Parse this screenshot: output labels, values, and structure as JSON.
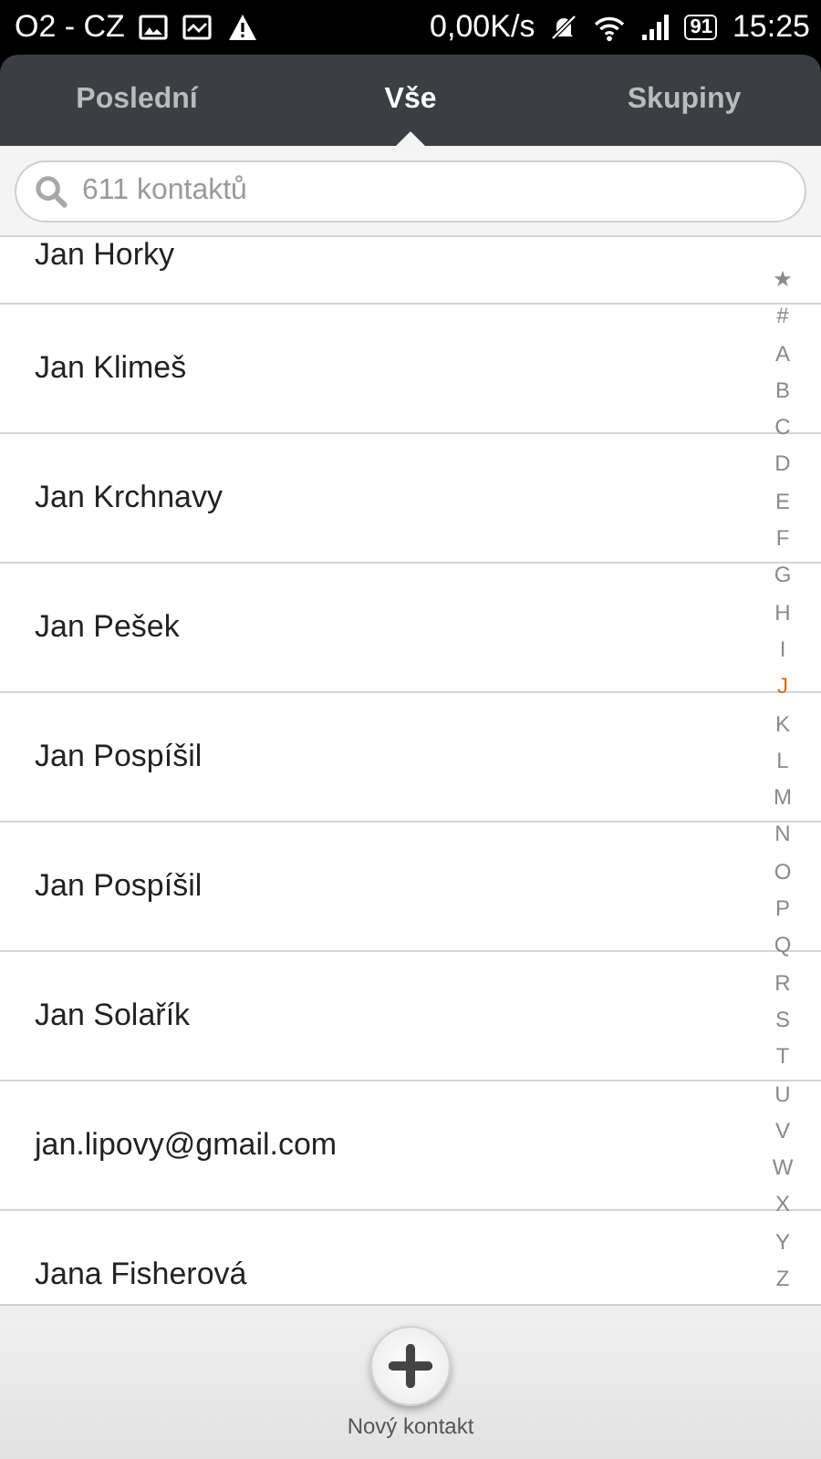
{
  "status_bar": {
    "carrier": "O2 - CZ",
    "speed": "0,00K/s",
    "battery": "91",
    "time": "15:25"
  },
  "tabs": [
    {
      "label": "Poslední",
      "selected": false
    },
    {
      "label": "Vše",
      "selected": true
    },
    {
      "label": "Skupiny",
      "selected": false
    }
  ],
  "search": {
    "placeholder": "611 kontaktů"
  },
  "contacts": [
    "Jan Horky",
    "Jan Klimeš",
    "Jan Krchnavy",
    "Jan Pešek",
    "Jan Pospíšil",
    "Jan Pospíšil",
    "Jan Solařík",
    "jan.lipovy@gmail.com",
    "Jana Fisherová"
  ],
  "index": [
    {
      "label": "★",
      "selected": false
    },
    {
      "label": "#",
      "selected": false
    },
    {
      "label": "A",
      "selected": false
    },
    {
      "label": "B",
      "selected": false
    },
    {
      "label": "C",
      "selected": false
    },
    {
      "label": "D",
      "selected": false
    },
    {
      "label": "E",
      "selected": false
    },
    {
      "label": "F",
      "selected": false
    },
    {
      "label": "G",
      "selected": false
    },
    {
      "label": "H",
      "selected": false
    },
    {
      "label": "I",
      "selected": false
    },
    {
      "label": "J",
      "selected": true
    },
    {
      "label": "K",
      "selected": false
    },
    {
      "label": "L",
      "selected": false
    },
    {
      "label": "M",
      "selected": false
    },
    {
      "label": "N",
      "selected": false
    },
    {
      "label": "O",
      "selected": false
    },
    {
      "label": "P",
      "selected": false
    },
    {
      "label": "Q",
      "selected": false
    },
    {
      "label": "R",
      "selected": false
    },
    {
      "label": "S",
      "selected": false
    },
    {
      "label": "T",
      "selected": false
    },
    {
      "label": "U",
      "selected": false
    },
    {
      "label": "V",
      "selected": false
    },
    {
      "label": "W",
      "selected": false
    },
    {
      "label": "X",
      "selected": false
    },
    {
      "label": "Y",
      "selected": false
    },
    {
      "label": "Z",
      "selected": false
    }
  ],
  "new_contact": {
    "label": "Nový kontakt"
  }
}
